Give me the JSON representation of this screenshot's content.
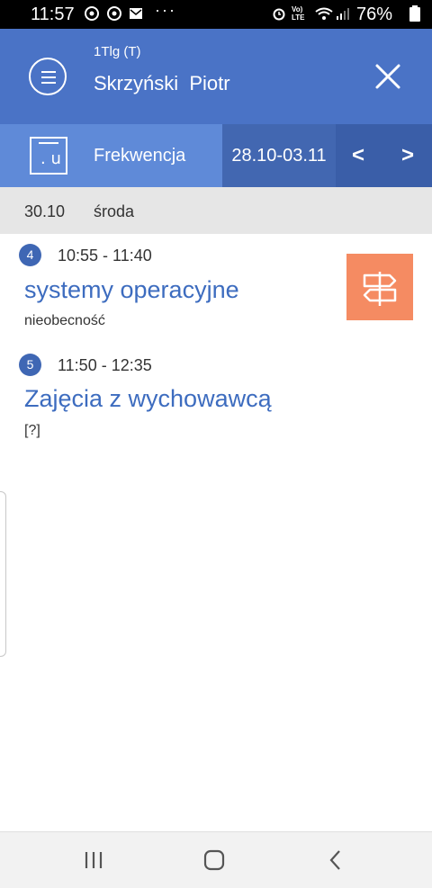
{
  "status_bar": {
    "time": "11:57",
    "icons": [
      "chrome-icon",
      "chrome-icon",
      "mail-icon"
    ],
    "more": "···",
    "right_icons": [
      "alarm-icon",
      "volte-icon",
      "wifi-icon",
      "signal-icon",
      "battery-icon"
    ],
    "volte_label": "Vo) LTE",
    "battery": "76%"
  },
  "header": {
    "class_label": "1Tlg (T)",
    "student_name": "Skrzyński  Piotr",
    "menu_icon": "hamburger-menu-icon",
    "close_icon": "close-icon"
  },
  "module_bar": {
    "icon_label": ". u",
    "title": "Frekwencja",
    "date_range": "28.10-03.11",
    "prev": "<",
    "next": ">"
  },
  "day": {
    "date": "30.10",
    "name": "środa"
  },
  "lessons": [
    {
      "number": "4",
      "time": "10:55 - 11:40",
      "subject": "systemy operacyjne",
      "status": "nieobecność",
      "status_icon": "signpost-icon",
      "status_color": "#f58b62"
    },
    {
      "number": "5",
      "time": "11:50 - 12:35",
      "subject": "Zajęcia z wychowawcą",
      "status": "[?]"
    }
  ],
  "colors": {
    "header": "#4a73c6",
    "module_bar": "#5f8ad8",
    "date_range_bg": "#4267b1",
    "nav_bg": "#3a5ea8",
    "accent_text": "#3d6cbf"
  },
  "nav_bar": {
    "icons": [
      "recent-apps-icon",
      "home-icon",
      "back-icon"
    ]
  }
}
